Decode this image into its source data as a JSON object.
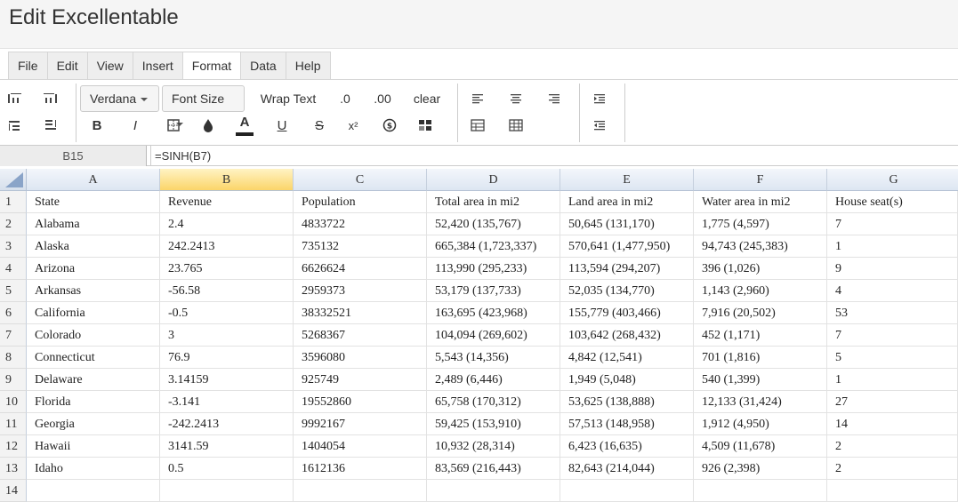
{
  "app": {
    "title": "Edit Excellentable"
  },
  "menu": {
    "tabs": [
      {
        "label": "File"
      },
      {
        "label": "Edit"
      },
      {
        "label": "View"
      },
      {
        "label": "Insert"
      },
      {
        "label": "Format",
        "active": true
      },
      {
        "label": "Data"
      },
      {
        "label": "Help"
      }
    ]
  },
  "toolbar": {
    "font_family": "Verdana",
    "font_size": "Font Size",
    "wrap_text": "Wrap Text",
    "decrease_decimal": ".0",
    "increase_decimal": ".00",
    "clear": "clear",
    "bold": "B",
    "italic": "I",
    "text_color": "A",
    "underline": "U",
    "strikethrough": "S",
    "superscript": "x²"
  },
  "formula_bar": {
    "cell_ref": "B15",
    "formula": "=SINH(B7)"
  },
  "colors": {
    "selected_header": "#fbd569",
    "header": "#dde6f2",
    "text_color_bar": "#222222"
  },
  "sheet": {
    "columns": [
      "A",
      "B",
      "C",
      "D",
      "E",
      "F",
      "G"
    ],
    "selected_column": "B",
    "row_numbers": [
      "1",
      "2",
      "3",
      "4",
      "5",
      "6",
      "7",
      "8",
      "9",
      "10",
      "11",
      "12",
      "13",
      "14"
    ],
    "rows": [
      [
        "State",
        "Revenue",
        "Population",
        "Total area in mi2",
        "Land area in mi2",
        "Water area in mi2",
        "House seat(s)"
      ],
      [
        "Alabama",
        "2.4",
        "4833722",
        "52,420 (135,767)",
        "50,645 (131,170)",
        "1,775 (4,597)",
        "7"
      ],
      [
        "Alaska",
        "242.2413",
        "735132",
        "665,384 (1,723,337)",
        "570,641 (1,477,950)",
        "94,743 (245,383)",
        "1"
      ],
      [
        "Arizona",
        "23.765",
        "6626624",
        "113,990 (295,233)",
        "113,594 (294,207)",
        "396 (1,026)",
        "9"
      ],
      [
        "Arkansas",
        "-56.58",
        "2959373",
        "53,179 (137,733)",
        "52,035 (134,770)",
        "1,143 (2,960)",
        "4"
      ],
      [
        "California",
        "-0.5",
        "38332521",
        "163,695 (423,968)",
        "155,779 (403,466)",
        "7,916 (20,502)",
        "53"
      ],
      [
        "Colorado",
        "3",
        "5268367",
        "104,094 (269,602)",
        "103,642 (268,432)",
        "452 (1,171)",
        "7"
      ],
      [
        "Connecticut",
        "76.9",
        "3596080",
        "5,543 (14,356)",
        "4,842 (12,541)",
        "701 (1,816)",
        "5"
      ],
      [
        "Delaware",
        "3.14159",
        "925749",
        "2,489 (6,446)",
        "1,949 (5,048)",
        "540 (1,399)",
        "1"
      ],
      [
        "Florida",
        "-3.141",
        "19552860",
        "65,758 (170,312)",
        "53,625 (138,888)",
        "12,133 (31,424)",
        "27"
      ],
      [
        "Georgia",
        "-242.2413",
        "9992167",
        "59,425 (153,910)",
        "57,513 (148,958)",
        "1,912 (4,950)",
        "14"
      ],
      [
        "Hawaii",
        "3141.59",
        "1404054",
        "10,932 (28,314)",
        "6,423 (16,635)",
        "4,509 (11,678)",
        "2"
      ],
      [
        "Idaho",
        "0.5",
        "1612136",
        "83,569 (216,443)",
        "82,643 (214,044)",
        "926 (2,398)",
        "2"
      ],
      [
        "",
        "",
        "",
        "",
        "",
        "",
        ""
      ]
    ]
  }
}
